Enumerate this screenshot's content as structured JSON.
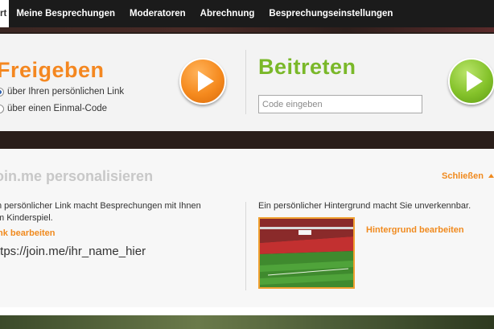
{
  "nav": {
    "items": [
      {
        "label": "rt"
      },
      {
        "label": "Meine Besprechungen"
      },
      {
        "label": "Moderatoren"
      },
      {
        "label": "Abrechnung"
      },
      {
        "label": "Besprechungseinstellungen"
      }
    ]
  },
  "share": {
    "title": "Freigeben",
    "option_link": "über Ihren persönlichen Link",
    "option_code": "über einen Einmal-Code",
    "selected": "link"
  },
  "join": {
    "title": "Beitreten",
    "code_placeholder": "Code eingeben",
    "code_value": ""
  },
  "personalize": {
    "title": "oin.me personalisieren",
    "close_label": "Schließen",
    "link_text_line1": "n persönlicher Link macht Besprechungen mit Ihnen",
    "link_text_line2": "m Kinderspiel.",
    "edit_link_label": "nk bearbeiten",
    "url": "ttps://join.me/ihr_name_hier",
    "bg_text": "Ein persönlicher Hintergrund macht Sie unverkennbar.",
    "edit_bg_label": "Hintergrund bearbeiten"
  },
  "colors": {
    "orange": "#f48720",
    "green": "#7ab829",
    "nav_bg": "#1b1b1b"
  },
  "icons": {
    "play_orange": "play-icon",
    "play_green": "play-icon",
    "close_arrow": "triangle-up-icon"
  }
}
